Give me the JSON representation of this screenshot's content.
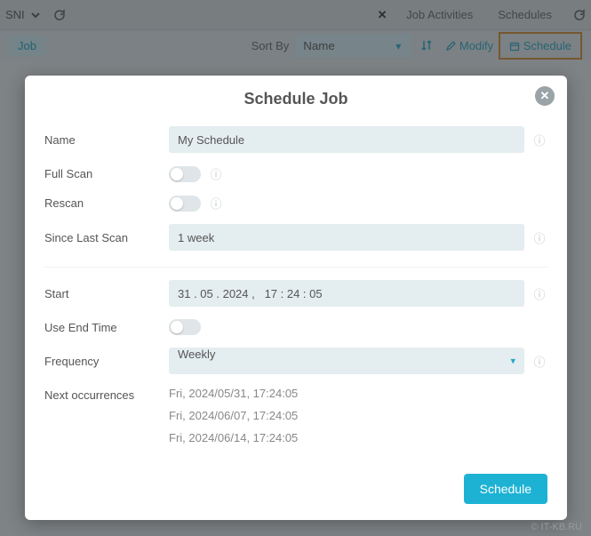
{
  "topbar": {
    "sni": "SNI",
    "tabJobActivities": "Job Activities",
    "tabSchedules": "Schedules"
  },
  "sortbar": {
    "jobChip": "Job",
    "sortByLabel": "Sort By",
    "sortValue": "Name",
    "modify": "Modify",
    "schedule": "Schedule"
  },
  "modal": {
    "title": "Schedule Job",
    "labels": {
      "name": "Name",
      "fullScan": "Full Scan",
      "rescan": "Rescan",
      "sinceLast": "Since Last Scan",
      "start": "Start",
      "useEnd": "Use End Time",
      "frequency": "Frequency",
      "nextOcc": "Next occurrences"
    },
    "fields": {
      "name": "My Schedule",
      "sinceLast": "1 week",
      "start": "31 . 05 . 2024 ,   17 : 24 : 05",
      "frequency": "Weekly"
    },
    "occurrences": [
      "Fri, 2024/05/31, 17:24:05",
      "Fri, 2024/06/07, 17:24:05",
      "Fri, 2024/06/14, 17:24:05"
    ],
    "submit": "Schedule"
  },
  "watermark": "© IT-KB.RU"
}
